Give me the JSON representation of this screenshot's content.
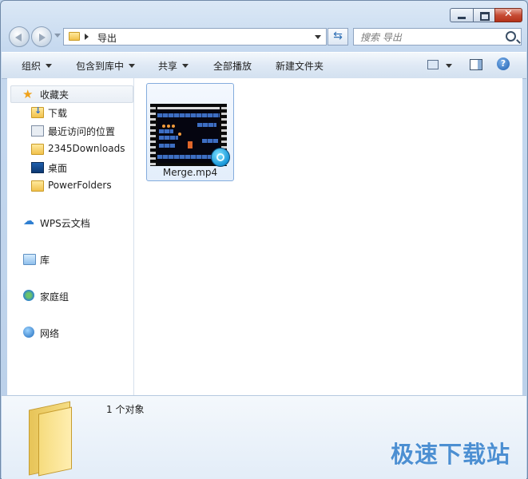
{
  "window": {
    "caption_buttons": {
      "close_glyph": "✕"
    }
  },
  "addressbar": {
    "current_folder": "导出"
  },
  "search": {
    "placeholder": "搜索 导出"
  },
  "toolbar": {
    "organize": "组织",
    "include_in_library": "包含到库中",
    "share": "共享",
    "play_all": "全部播放",
    "new_folder": "新建文件夹",
    "help_glyph": "?"
  },
  "sidebar": {
    "favorites": "收藏夹",
    "favorites_items": [
      "下载",
      "最近访问的位置",
      "2345Downloads",
      "桌面",
      "PowerFolders"
    ],
    "wps_cloud": "WPS云文档",
    "libraries": "库",
    "homegroup": "家庭组",
    "network": "网络"
  },
  "files": [
    {
      "name": "Merge.mp4",
      "type": "video"
    }
  ],
  "details": {
    "item_count": "1 个对象"
  },
  "watermark": "极速下载站",
  "colors": {
    "accent": "#2f6fb5",
    "close_button": "#c74c35",
    "selection_border": "#84acdd",
    "watermark": "#4c8fd2"
  }
}
